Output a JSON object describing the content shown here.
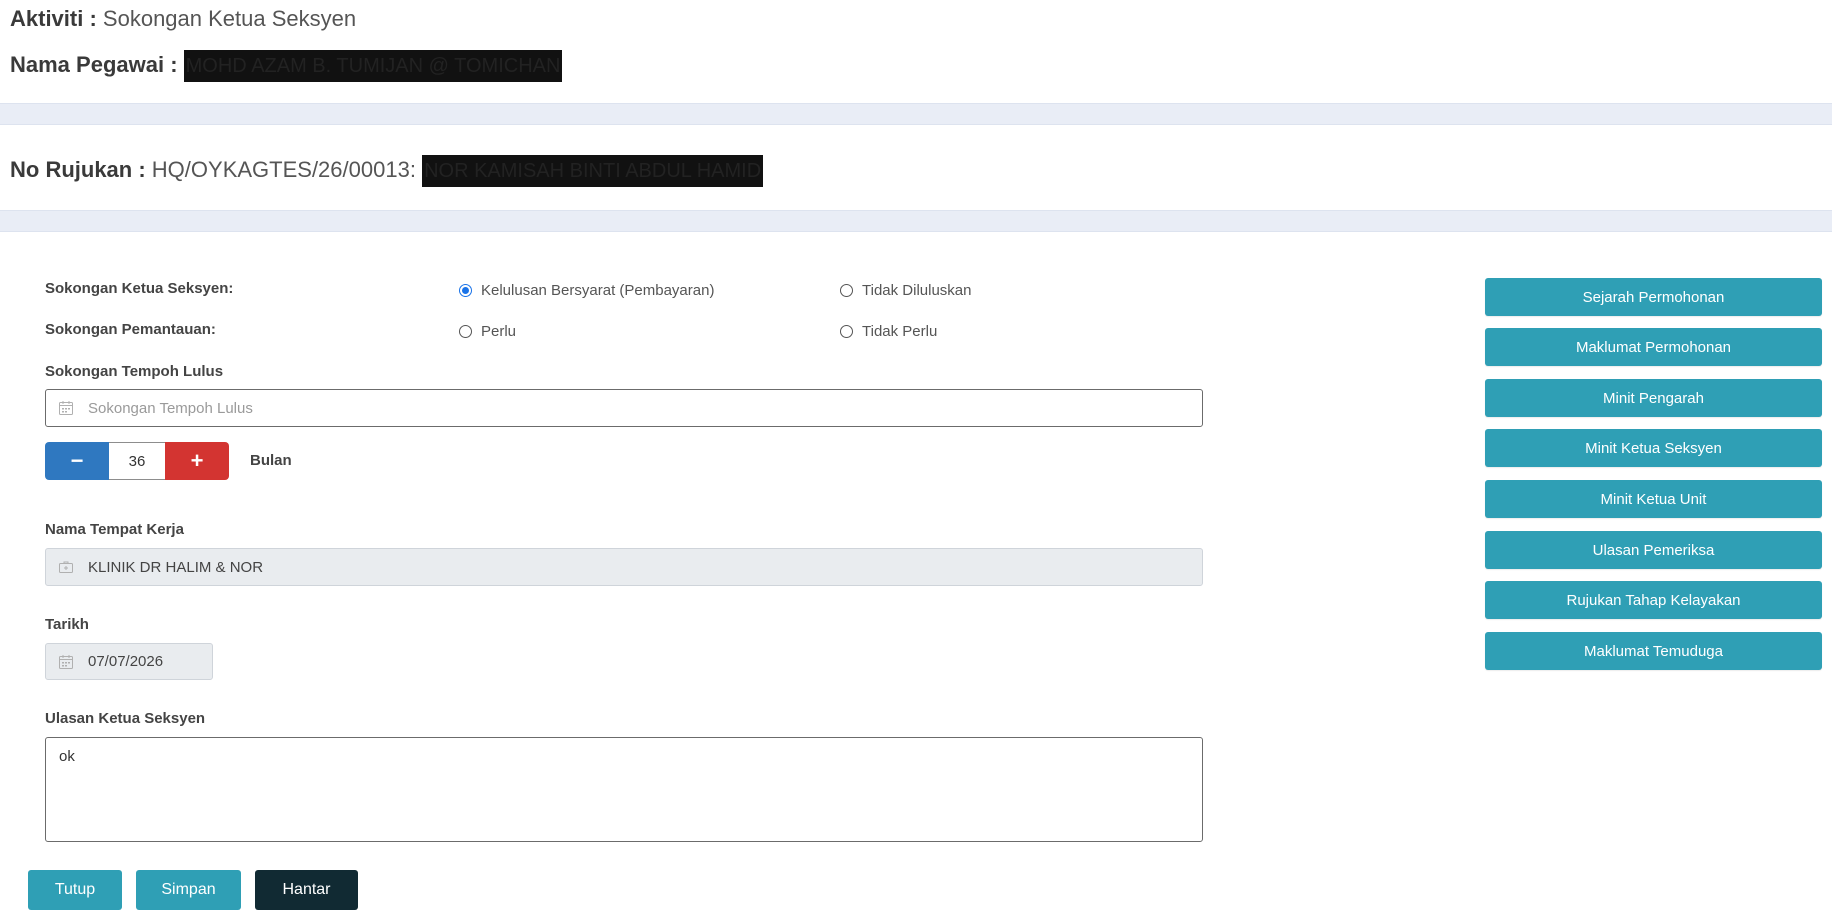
{
  "header": {
    "aktiviti_label": "Aktiviti :",
    "aktiviti_value": "Sokongan Ketua Seksyen",
    "nama_pegawai_label": "Nama Pegawai :",
    "nama_pegawai_value": "MOHD AZAM B. TUMIJAN @ TOMICHAN",
    "no_rujukan_label": "No Rujukan :",
    "no_rujukan_value": "HQ/OYKAGTES/26/00013:",
    "no_rujukan_name": "NOR KAMISAH BINTI ABDUL HAMID"
  },
  "form": {
    "sokongan_ketua_label": "Sokongan Ketua Seksyen:",
    "sokongan_ketua_options": [
      "Kelulusan Bersyarat (Pembayaran)",
      "Tidak Diluluskan"
    ],
    "sokongan_ketua_selected": "Kelulusan Bersyarat (Pembayaran)",
    "sokongan_pemantauan_label": "Sokongan Pemantauan:",
    "sokongan_pemantauan_options": [
      "Perlu",
      "Tidak Perlu"
    ],
    "tempoh_label": "Sokongan Tempoh Lulus",
    "tempoh_placeholder": "Sokongan Tempoh Lulus",
    "stepper_minus": "−",
    "stepper_value": "36",
    "stepper_plus": "+",
    "stepper_unit": "Bulan",
    "tempat_kerja_label": "Nama Tempat Kerja",
    "tempat_kerja_value": "KLINIK DR HALIM & NOR",
    "tarikh_label": "Tarikh",
    "tarikh_value": "07/07/2026",
    "ulasan_label": "Ulasan Ketua Seksyen",
    "ulasan_value": "ok"
  },
  "sidebar": {
    "buttons": [
      "Sejarah Permohonan",
      "Maklumat Permohonan",
      "Minit Pengarah",
      "Minit Ketua Seksyen",
      "Minit Ketua Unit",
      "Ulasan Pemeriksa",
      "Rujukan Tahap Kelayakan",
      "Maklumat Temuduga"
    ]
  },
  "actions": {
    "tutup": "Tutup",
    "simpan": "Simpan",
    "hantar": "Hantar"
  },
  "colors": {
    "teal": "#2f9fb5",
    "dark": "#112a33",
    "stepper_minus": "#2f78c0",
    "stepper_plus": "#d33431",
    "band": "#e9edf6",
    "radio_checked": "#1a73e8"
  },
  "icons": {
    "tempoh_input": "calendar-icon",
    "tempat_kerja_input": "medical-kit-icon",
    "tarikh_input": "calendar-icon"
  }
}
